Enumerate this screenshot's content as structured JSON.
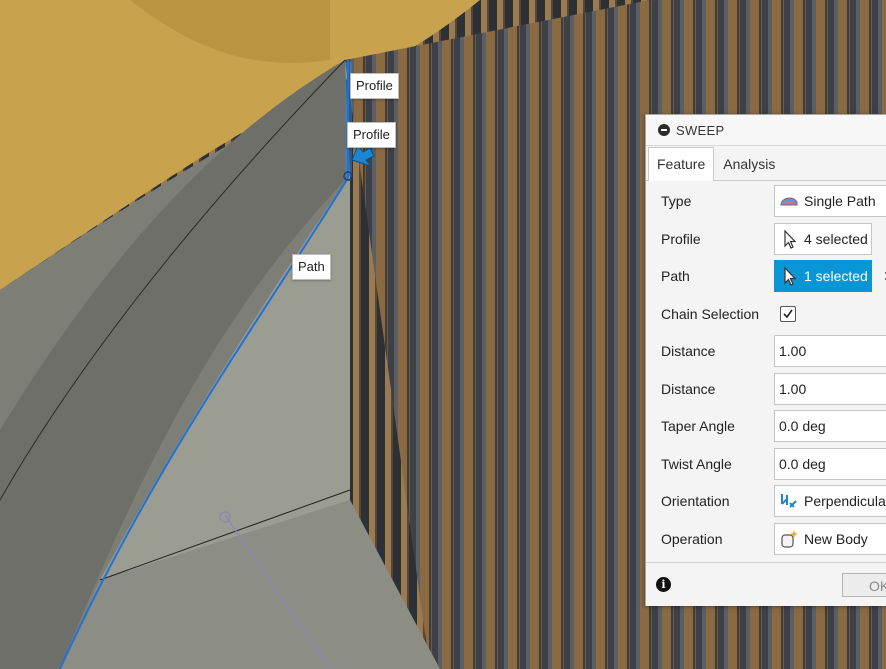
{
  "callouts": {
    "profile_top": "Profile",
    "profile_bottom": "Profile",
    "path": "Path"
  },
  "panel": {
    "title": "SWEEP",
    "tabs": [
      "Feature",
      "Analysis"
    ],
    "rows": {
      "type": {
        "label": "Type",
        "value": "Single Path",
        "icon": "single-path-icon"
      },
      "profile": {
        "label": "Profile",
        "value": "4 selected",
        "icon": "cursor-arrow-icon"
      },
      "path": {
        "label": "Path",
        "value": "1 selected",
        "icon": "cursor-arrow-icon"
      },
      "chain_selection": {
        "label": "Chain Selection",
        "checked": true
      },
      "distance1": {
        "label": "Distance",
        "value": "1.00"
      },
      "distance2": {
        "label": "Distance",
        "value": "1.00"
      },
      "taper_angle": {
        "label": "Taper Angle",
        "value": "0.0 deg"
      },
      "twist_angle": {
        "label": "Twist Angle",
        "value": "0.0 deg"
      },
      "orientation": {
        "label": "Orientation",
        "value": "Perpendicular",
        "icon": "perpendicular-icon"
      },
      "operation": {
        "label": "Operation",
        "value": "New Body",
        "icon": "new-body-icon"
      }
    },
    "footer": {
      "ok": "OK"
    }
  },
  "colors": {
    "accent": "#0a96d6",
    "floor_wood": "#c9a24e",
    "concrete": "#8e8f84",
    "stud": "#8a6a43"
  }
}
